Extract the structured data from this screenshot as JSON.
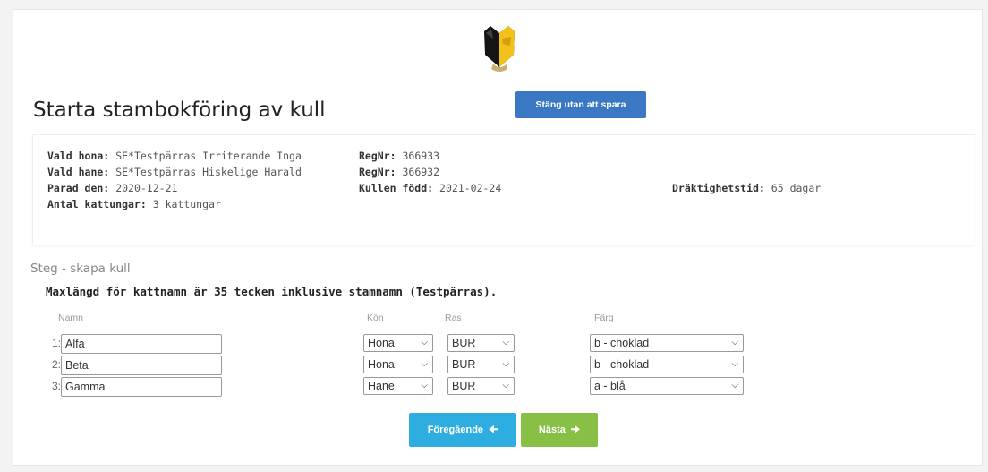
{
  "header": {
    "title": "Starta stambokföring av kull",
    "close_button": "Stäng utan att spara"
  },
  "info": {
    "hona_label": "Vald hona:",
    "hona_value": "SE*Testpärras Irriterande Inga",
    "hona_reg_label": "RegNr:",
    "hona_reg_value": "366933",
    "hane_label": "Vald hane:",
    "hane_value": "SE*Testpärras Hiskelige Harald",
    "hane_reg_label": "RegNr:",
    "hane_reg_value": "366932",
    "parad_label": "Parad den:",
    "parad_value": "2020-12-21",
    "fodd_label": "Kullen född:",
    "fodd_value": "2021-02-24",
    "drakt_label": "Dräktighetstid:",
    "drakt_value": "65 dagar",
    "antal_label": "Antal kattungar:",
    "antal_value": "3 kattungar"
  },
  "step": {
    "title": "Steg - skapa kull",
    "maxlen_note": "Maxlängd för kattnamn är 35 tecken inklusive stamnamn (Testpärras)."
  },
  "columns": {
    "name": "Namn",
    "sex": "Kön",
    "breed": "Ras",
    "color": "Färg"
  },
  "kittens": [
    {
      "num": "1:",
      "name": "Alfa",
      "sex": "Hona",
      "breed": "BUR",
      "color": "b - choklad"
    },
    {
      "num": "2:",
      "name": "Beta",
      "sex": "Hona",
      "breed": "BUR",
      "color": "b - choklad"
    },
    {
      "num": "3:",
      "name": "Gamma",
      "sex": "Hane",
      "breed": "BUR",
      "color": "a - blå"
    }
  ],
  "nav": {
    "prev": "Föregående",
    "next": "Nästa"
  },
  "colors": {
    "close_button": "#3a78c3",
    "prev_button": "#2eaee0",
    "next_button": "#88c046"
  },
  "icons": {
    "logo": "cat-mask-logo",
    "prev": "arrow-left-icon",
    "next": "arrow-right-icon",
    "dropdown": "chevron-down-icon"
  }
}
